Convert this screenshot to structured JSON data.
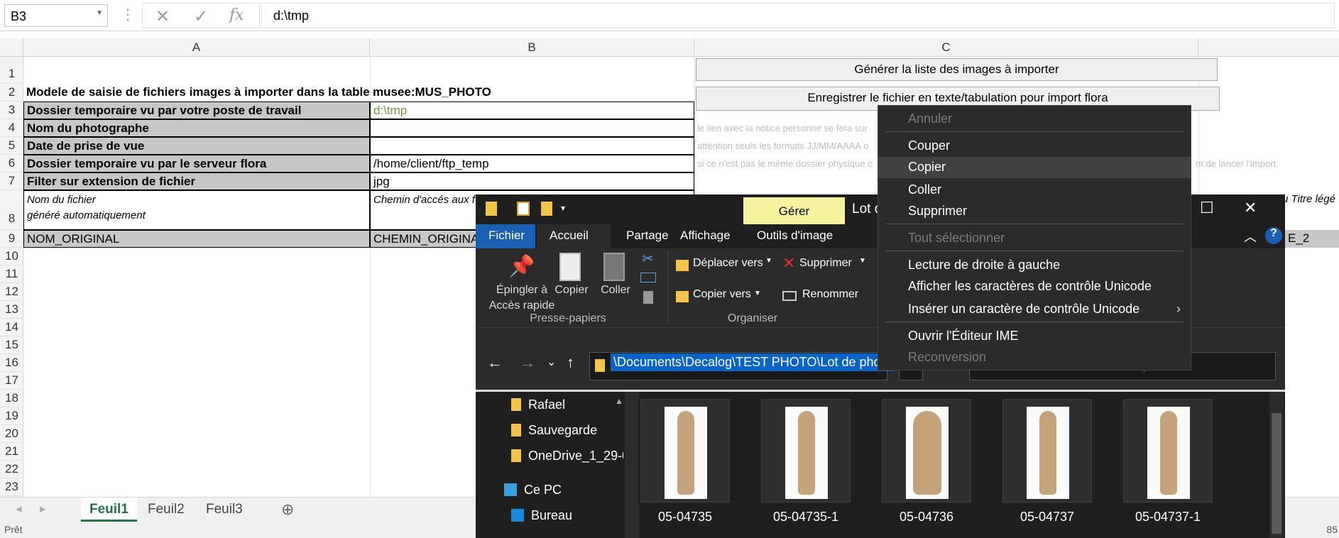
{
  "formula_bar": {
    "name_box": "B3",
    "fx": "fx",
    "value": "d:\\tmp"
  },
  "columns": [
    "A",
    "B",
    "C"
  ],
  "rows": [
    "1",
    "2",
    "3",
    "4",
    "5",
    "6",
    "7",
    "8",
    "9",
    "10",
    "11",
    "12",
    "13",
    "14",
    "15",
    "16",
    "17",
    "18",
    "19",
    "20",
    "21",
    "22",
    "23"
  ],
  "cells": {
    "a2": "Modele de saisie de fichiers images à importer dans la table",
    "b2": "musee:MUS_PHOTO",
    "a3": "Dossier temporaire vu par votre poste de travail",
    "b3": "d:\\tmp",
    "a4": "Nom du photographe",
    "a5": "Date de prise de vue",
    "a6": "Dossier temporaire vu par le serveur flora",
    "b6": "/home/client/ftp_temp",
    "a7": "Filter sur extension de fichier",
    "b7": "jpg",
    "a8_line1": "Nom du fichier",
    "a8_line2": "généré automatiquement",
    "b8": "Chemin d'accés aux f",
    "c8_tail": "u Titre légé",
    "a9": "NOM_ORIGINAL",
    "b9": "CHEMIN_ORIGINA",
    "c9_tail": "E_2",
    "c4_note": "le lien avec la notice personne se fera sur",
    "c5_note": "attention seuls les formats JJ/MM/AAAA o",
    "c6_note": "si ce n'est pas le même dossier physique c",
    "c6_note_tail": "nt de lancer l'import"
  },
  "buttons": {
    "generate": "Générer la liste des images à importer",
    "save": "Enregistrer le fichier en texte/tabulation pour import flora"
  },
  "sheet_tabs": [
    "Feuil1",
    "Feuil2",
    "Feuil3"
  ],
  "active_sheet": "Feuil1",
  "status": {
    "left": "Prêt",
    "zoom": "85"
  },
  "explorer": {
    "manage_tab": "Gérer",
    "title": "Lot d",
    "ribbon_tabs": [
      "Fichier",
      "Accueil",
      "Partage",
      "Affichage",
      "Outils d'image"
    ],
    "clipboard": {
      "pin": "Épingler à",
      "pin2": "Accès rapide",
      "copy": "Copier",
      "paste": "Coller",
      "group": "Presse-papiers"
    },
    "organize": {
      "move": "Déplacer vers",
      "copy_to": "Copier vers",
      "delete": "Supprimer",
      "rename": "Renommer",
      "group": "Organiser"
    },
    "address": "\\Documents\\Decalog\\TEST PHOTO\\Lot de photo",
    "search_placeholder": "Rechercher dans : Lot de photo",
    "nav": [
      "Rafael",
      "Sauvegarde",
      "OneDrive_1_29-0",
      "Ce PC",
      "Bureau"
    ],
    "files": [
      "05-04735",
      "05-04735-1",
      "05-04736",
      "05-04737",
      "05-04737-1"
    ]
  },
  "context_menu": {
    "undo": "Annuler",
    "cut": "Couper",
    "copy": "Copier",
    "paste": "Coller",
    "delete": "Supprimer",
    "select_all": "Tout sélectionner",
    "rtl": "Lecture de droite à gauche",
    "show_unicode": "Afficher les caractères de contrôle Unicode",
    "insert_unicode": "Insérer un caractère de contrôle Unicode",
    "ime": "Ouvrir l'Éditeur IME",
    "reconversion": "Reconversion"
  }
}
